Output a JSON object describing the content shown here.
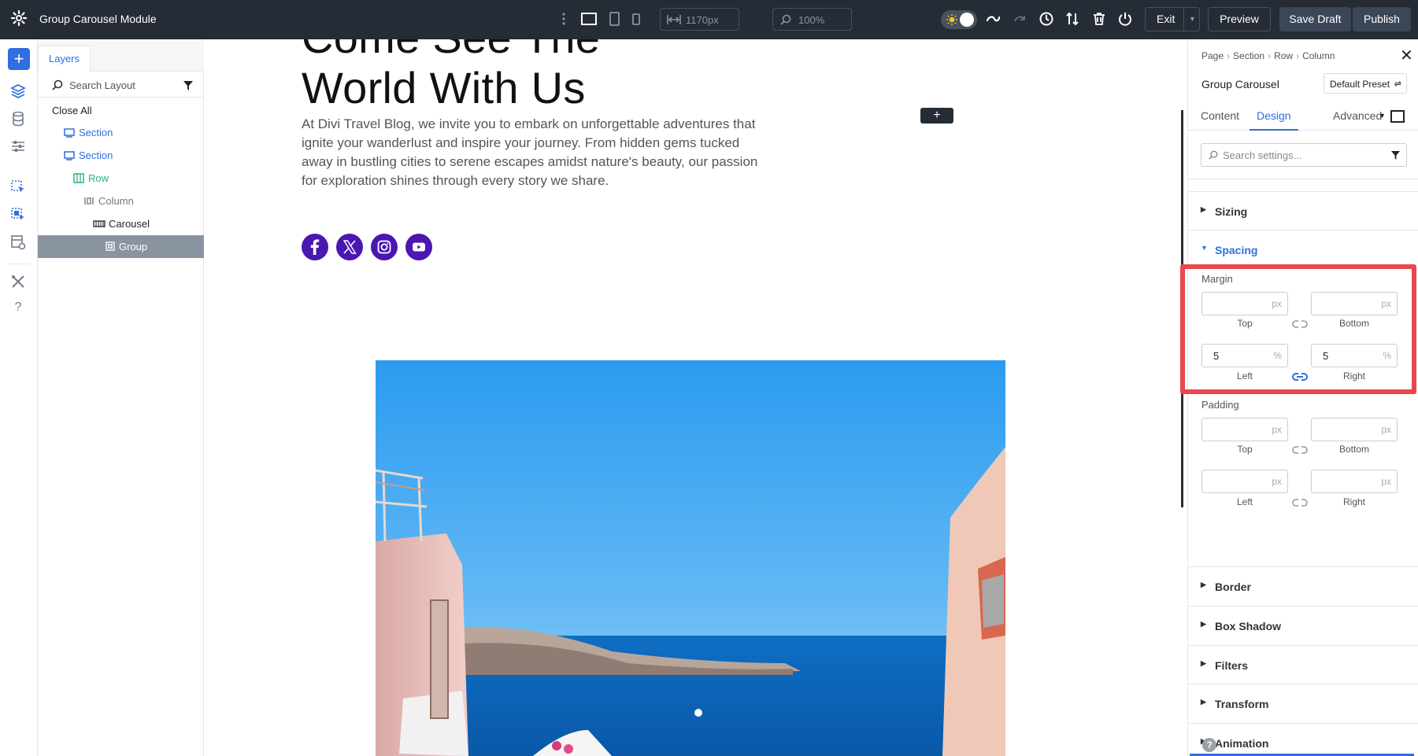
{
  "topbar": {
    "app_title": "Group Carousel Module",
    "width_value": "1170px",
    "zoom_value": "100%",
    "exit_label": "Exit",
    "preview_label": "Preview",
    "save_draft_label": "Save Draft",
    "publish_label": "Publish"
  },
  "layers": {
    "tab_label": "Layers",
    "search_placeholder": "Search Layout",
    "close_all_label": "Close All",
    "items": [
      {
        "label": "Section",
        "type": "section",
        "color": "#2f6fe0"
      },
      {
        "label": "Section",
        "type": "section",
        "color": "#2f6fe0"
      },
      {
        "label": "Row",
        "type": "row",
        "color": "#29b57c"
      },
      {
        "label": "Column",
        "type": "column",
        "color": "#777777"
      },
      {
        "label": "Carousel",
        "type": "carousel",
        "color": "#222222"
      },
      {
        "label": "Group",
        "type": "group",
        "color": "#ffffff",
        "selected": true
      }
    ]
  },
  "canvas": {
    "hero_title_line1": "Come See The",
    "hero_title_line2": "World With Us",
    "hero_text": "At Divi Travel Blog, we invite you to embark on unforgettable adventures that ignite your wanderlust and inspire your journey. From hidden gems tucked away in bustling cities to serene escapes amidst nature's beauty, our passion for exploration shines through every story we share.",
    "social_icons": [
      "facebook-icon",
      "x-icon",
      "instagram-icon",
      "youtube-icon"
    ],
    "add_button_label": "+",
    "accent_color": "#4a17b0"
  },
  "settings": {
    "breadcrumb": [
      "Page",
      "Section",
      "Row",
      "Column"
    ],
    "module_title": "Group Carousel",
    "preset_label": "Default Preset",
    "tabs": [
      "Content",
      "Design",
      "Advanced"
    ],
    "active_tab": "Design",
    "search_placeholder": "Search settings...",
    "sections": {
      "sizing": "Sizing",
      "spacing": "Spacing",
      "border": "Border",
      "box_shadow": "Box Shadow",
      "filters": "Filters",
      "transform": "Transform",
      "animation": "Animation"
    },
    "margin": {
      "label": "Margin",
      "top": {
        "value": "",
        "unit": "px",
        "label": "Top"
      },
      "bottom": {
        "value": "",
        "unit": "px",
        "label": "Bottom"
      },
      "left": {
        "value": "5",
        "unit": "%",
        "label": "Left"
      },
      "right": {
        "value": "5",
        "unit": "%",
        "label": "Right"
      }
    },
    "padding": {
      "label": "Padding",
      "top": {
        "value": "",
        "unit": "px",
        "label": "Top"
      },
      "bottom": {
        "value": "",
        "unit": "px",
        "label": "Bottom"
      },
      "left": {
        "value": "",
        "unit": "px",
        "label": "Left"
      },
      "right": {
        "value": "",
        "unit": "px",
        "label": "Right"
      }
    },
    "highlight_color": "#e8474d",
    "link_active_color": "#2f6fe0"
  }
}
